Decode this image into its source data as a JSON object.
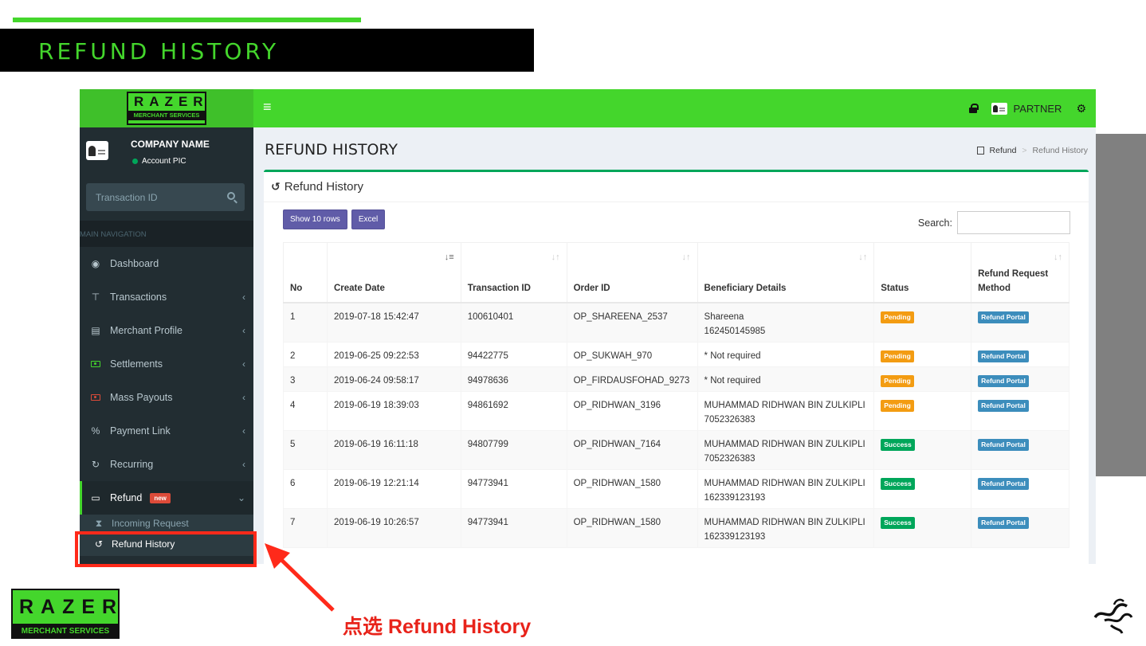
{
  "slide": {
    "title": "REFUND HISTORY",
    "annotation": "点选 Refund History"
  },
  "brand": {
    "wordmark": "RAZER",
    "subtitle": "MERCHANT SERVICES"
  },
  "topbar": {
    "user_label": "PARTNER"
  },
  "sidebar": {
    "company_name": "COMPANY NAME",
    "account_label": "Account PIC",
    "search_placeholder": "Transaction ID",
    "nav_header": "MAIN NAVIGATION",
    "items": [
      {
        "label": "Dashboard",
        "icon": "dashboard-icon"
      },
      {
        "label": "Transactions",
        "icon": "cart-icon"
      },
      {
        "label": "Merchant Profile",
        "icon": "building-icon"
      },
      {
        "label": "Settlements",
        "icon": "money-icon"
      },
      {
        "label": "Mass Payouts",
        "icon": "money-icon"
      },
      {
        "label": "Payment Link",
        "icon": "link-icon"
      },
      {
        "label": "Recurring",
        "icon": "refresh-icon"
      },
      {
        "label": "Refund",
        "icon": "inbox-icon",
        "badge": "new"
      }
    ],
    "subitems": [
      {
        "label": "Incoming Request",
        "icon": "hourglass-icon"
      },
      {
        "label": "Refund History",
        "icon": "history-icon"
      }
    ]
  },
  "content": {
    "page_title": "REFUND HISTORY",
    "breadcrumb": [
      "Refund",
      "Refund History"
    ],
    "box_title": "Refund History",
    "buttons": {
      "show_rows": "Show 10 rows",
      "excel": "Excel"
    },
    "search_label": "Search:",
    "columns": [
      "No",
      "Create Date",
      "Transaction ID",
      "Order ID",
      "Beneficiary Details",
      "Status",
      "Refund Request Method"
    ],
    "rows": [
      {
        "no": "1",
        "date": "2019-07-18 15:42:47",
        "txn": "100610401",
        "order": "OP_SHAREENA_2537",
        "ben": "Shareena",
        "ben2": "162450145985",
        "status": "Pending",
        "method": "Refund Portal"
      },
      {
        "no": "2",
        "date": "2019-06-25 09:22:53",
        "txn": "94422775",
        "order": "OP_SUKWAH_970",
        "ben": "* Not required",
        "ben2": "",
        "status": "Pending",
        "method": "Refund Portal"
      },
      {
        "no": "3",
        "date": "2019-06-24 09:58:17",
        "txn": "94978636",
        "order": "OP_FIRDAUSFOHAD_9273",
        "ben": "* Not required",
        "ben2": "",
        "status": "Pending",
        "method": "Refund Portal"
      },
      {
        "no": "4",
        "date": "2019-06-19 18:39:03",
        "txn": "94861692",
        "order": "OP_RIDHWAN_3196",
        "ben": "MUHAMMAD RIDHWAN BIN ZULKIPLI",
        "ben2": "7052326383",
        "status": "Pending",
        "method": "Refund Portal"
      },
      {
        "no": "5",
        "date": "2019-06-19 16:11:18",
        "txn": "94807799",
        "order": "OP_RIDHWAN_7164",
        "ben": "MUHAMMAD RIDHWAN BIN ZULKIPLI",
        "ben2": "7052326383",
        "status": "Success",
        "method": "Refund Portal"
      },
      {
        "no": "6",
        "date": "2019-06-19 12:21:14",
        "txn": "94773941",
        "order": "OP_RIDHWAN_1580",
        "ben": "MUHAMMAD RIDHWAN BIN ZULKIPLI",
        "ben2": "162339123193",
        "status": "Success",
        "method": "Refund Portal"
      },
      {
        "no": "7",
        "date": "2019-06-19 10:26:57",
        "txn": "94773941",
        "order": "OP_RIDHWAN_1580",
        "ben": "MUHAMMAD RIDHWAN BIN ZULKIPLI",
        "ben2": "162339123193",
        "status": "Success",
        "method": "Refund Portal"
      }
    ]
  },
  "colors": {
    "accent": "#44d62c",
    "sidebar": "#222d32",
    "pending": "#f39c12",
    "success": "#00a65a",
    "portal": "#3c8dbc",
    "highlight": "#ff2a1a"
  }
}
